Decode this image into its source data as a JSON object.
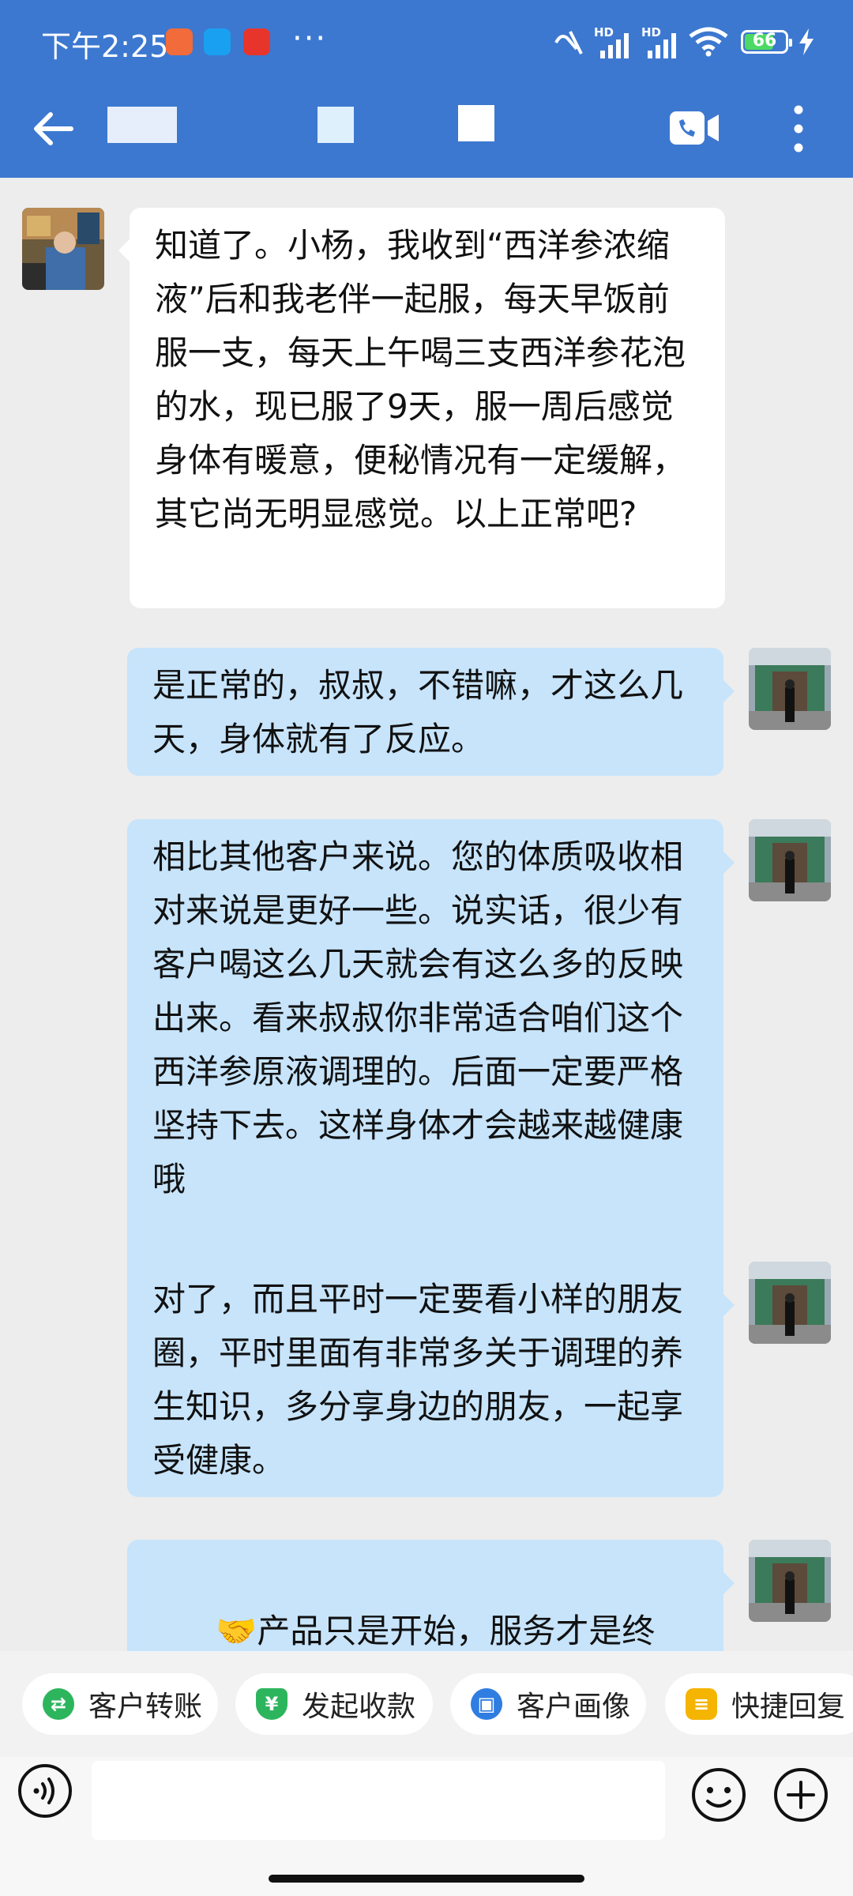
{
  "status_bar": {
    "time": "下午2:25",
    "battery": "66",
    "network_1": "HD",
    "network_2": "HD"
  },
  "header": {
    "back_icon": "arrow-left-icon",
    "video_icon": "video-call-icon",
    "menu_icon": "more-vertical-icon"
  },
  "messages": [
    {
      "side": "in",
      "text": "知道了。小杨，我收到“西洋参浓缩液”后和我老伴一起服，每天早饭前服一支，每天上午喝三支西洋参花泡的水，现已服了9天，服一周后感觉身体有暖意，便秘情况有一定缓解，其它尚无明显感觉。以上正常吧?"
    },
    {
      "side": "out",
      "text": "是正常的，叔叔，不错嘛，才这么几天，身体就有了反应。"
    },
    {
      "side": "out",
      "text": "相比其他客户来说。您的体质吸收相对来说是更好一些。说实话，很少有客户喝这么几天就会有这么多的反映出来。看来叔叔你非常适合咱们这个西洋参原液调理的。后面一定要严格坚持下去。这样身体才会越来越健康哦"
    },
    {
      "side": "out",
      "text": "对了，而且平时一定要看小样的朋友圈，平时里面有非常多关于调理的养生知识，多分享身边的朋友，一起享受健康。"
    },
    {
      "side": "out",
      "emoji": "🤝",
      "text": "产品只是开始，服务才是终身，您在饮用期间，我也会不定时的给"
    }
  ],
  "quick_actions": [
    {
      "label": "客户转账",
      "icon": "transfer-icon",
      "color": "#2db55d",
      "glyph": "⇄"
    },
    {
      "label": "发起收款",
      "icon": "payment-shield-icon",
      "color": "#2db55d",
      "glyph": "¥"
    },
    {
      "label": "客户画像",
      "icon": "profile-card-icon",
      "color": "#2f7de1",
      "glyph": "▣"
    },
    {
      "label": "快捷回复",
      "icon": "quick-reply-icon",
      "color": "#f5b400",
      "glyph": "≡"
    }
  ],
  "input": {
    "voice_icon": "voice-icon",
    "emoji_icon": "emoji-icon",
    "plus_icon": "plus-icon"
  },
  "colors": {
    "header_bg": "#3c78d0",
    "chat_bg": "#ededed",
    "outgoing_bubble": "#c7e4fb",
    "incoming_bubble": "#ffffff"
  }
}
